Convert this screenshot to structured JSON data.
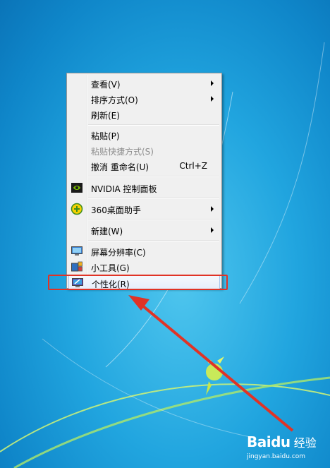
{
  "menu": {
    "items": [
      {
        "label": "查看(V)",
        "submenu": true
      },
      {
        "label": "排序方式(O)",
        "submenu": true
      },
      {
        "label": "刷新(E)"
      },
      {
        "label": "粘贴(P)"
      },
      {
        "label": "粘贴快捷方式(S)",
        "disabled": true
      },
      {
        "label": "撤消 重命名(U)",
        "shortcut": "Ctrl+Z"
      },
      {
        "label": "NVIDIA 控制面板",
        "icon": "nvidia-icon"
      },
      {
        "label": "360桌面助手",
        "icon": "360-assistant-icon",
        "submenu": true
      },
      {
        "label": "新建(W)",
        "submenu": true
      },
      {
        "label": "屏幕分辨率(C)",
        "icon": "screen-resolution-icon"
      },
      {
        "label": "小工具(G)",
        "icon": "gadgets-icon"
      },
      {
        "label": "个性化(R)",
        "icon": "personalize-icon",
        "highlighted": true
      }
    ]
  },
  "annotation": {
    "color": "#e03326"
  },
  "watermark": {
    "brand": "Bai",
    "brand_paw": "du",
    "brand_cn": "经验",
    "site": "jingyan.baidu.com"
  },
  "colors": {
    "desktop": "#1e9fdc",
    "menu_bg": "#f0f0f0",
    "menu_border": "#979797"
  }
}
